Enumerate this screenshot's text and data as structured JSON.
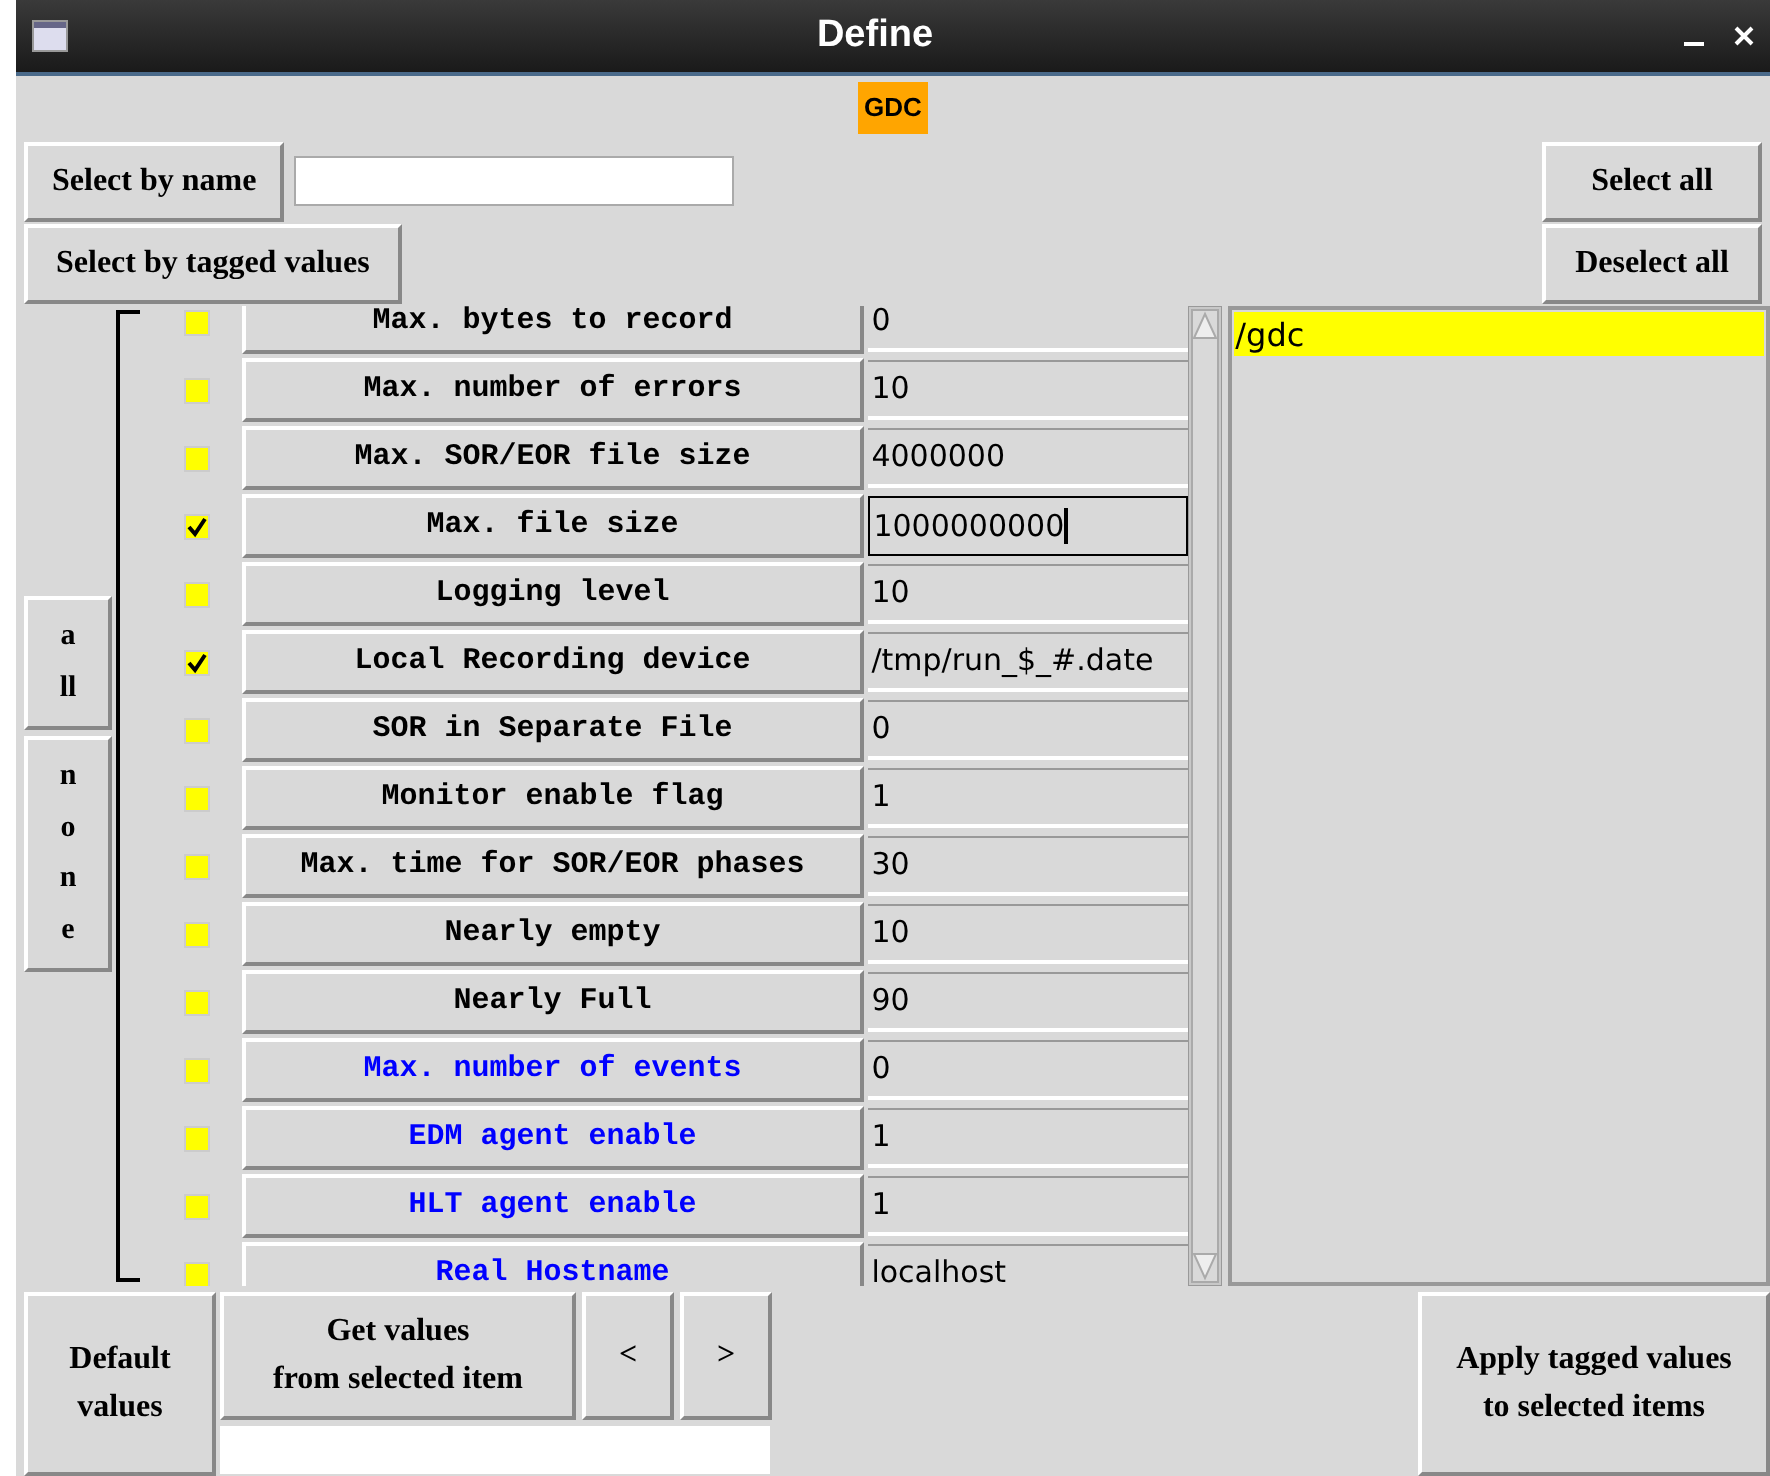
{
  "window": {
    "title": "Define"
  },
  "badge": "GDC",
  "select_by_name": {
    "button": "Select by name"
  },
  "select_by_tagged": "Select by tagged values",
  "select_all": "Select all",
  "deselect_all": "Deselect all",
  "side_buttons": [
    "all",
    "none"
  ],
  "parameters": [
    {
      "label": "Max. bytes to record",
      "value": "0",
      "checked": false,
      "color": "#000000",
      "focused": false
    },
    {
      "label": "Max. number of errors",
      "value": "10",
      "checked": false,
      "color": "#000000",
      "focused": false
    },
    {
      "label": "Max. SOR/EOR file size",
      "value": "4000000",
      "checked": false,
      "color": "#000000",
      "focused": false
    },
    {
      "label": "Max. file size",
      "value": "1000000000",
      "checked": true,
      "color": "#000000",
      "focused": true
    },
    {
      "label": "Logging level",
      "value": "10",
      "checked": false,
      "color": "#000000",
      "focused": false
    },
    {
      "label": "Local Recording device",
      "value": "/tmp/run_$_#.date",
      "checked": true,
      "color": "#000000",
      "focused": false
    },
    {
      "label": "SOR in Separate File",
      "value": "0",
      "checked": false,
      "color": "#000000",
      "focused": false
    },
    {
      "label": "Monitor enable flag",
      "value": "1",
      "checked": false,
      "color": "#000000",
      "focused": false
    },
    {
      "label": "Max. time for SOR/EOR phases",
      "value": "30",
      "checked": false,
      "color": "#000000",
      "focused": false
    },
    {
      "label": "Nearly empty",
      "value": "10",
      "checked": false,
      "color": "#000000",
      "focused": false
    },
    {
      "label": "Nearly Full",
      "value": "90",
      "checked": false,
      "color": "#000000",
      "focused": false
    },
    {
      "label": "Max. number of events",
      "value": "0",
      "checked": false,
      "color": "#0000ff",
      "focused": false
    },
    {
      "label": "EDM agent enable",
      "value": "1",
      "checked": false,
      "color": "#0000ff",
      "focused": false
    },
    {
      "label": "HLT agent enable",
      "value": "1",
      "checked": false,
      "color": "#0000ff",
      "focused": false
    },
    {
      "label": "Real Hostname",
      "value": "localhost",
      "checked": false,
      "color": "#0000ff",
      "focused": false
    }
  ],
  "items": [
    {
      "label": "/gdc",
      "selected": true
    }
  ],
  "bottom": {
    "default_values": [
      "Default",
      "values"
    ],
    "get_values": [
      "Get values",
      "from selected item"
    ],
    "prev": "<",
    "next": ">",
    "apply": [
      "Apply tagged values",
      "to selected items"
    ]
  }
}
